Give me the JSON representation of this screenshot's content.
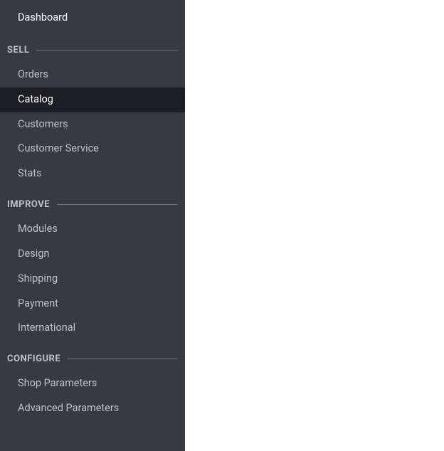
{
  "sidebar": {
    "top_item": "Dashboard",
    "sections": [
      {
        "title": "SELL",
        "items": [
          {
            "label": "Orders",
            "active": false
          },
          {
            "label": "Catalog",
            "active": true
          },
          {
            "label": "Customers",
            "active": false
          },
          {
            "label": "Customer Service",
            "active": false
          },
          {
            "label": "Stats",
            "active": false
          }
        ]
      },
      {
        "title": "IMPROVE",
        "items": [
          {
            "label": "Modules",
            "active": false
          },
          {
            "label": "Design",
            "active": false
          },
          {
            "label": "Shipping",
            "active": false
          },
          {
            "label": "Payment",
            "active": false
          },
          {
            "label": "International",
            "active": false
          }
        ]
      },
      {
        "title": "CONFIGURE",
        "items": [
          {
            "label": "Shop Parameters",
            "active": false
          },
          {
            "label": "Advanced Parameters",
            "active": false
          }
        ]
      }
    ]
  }
}
